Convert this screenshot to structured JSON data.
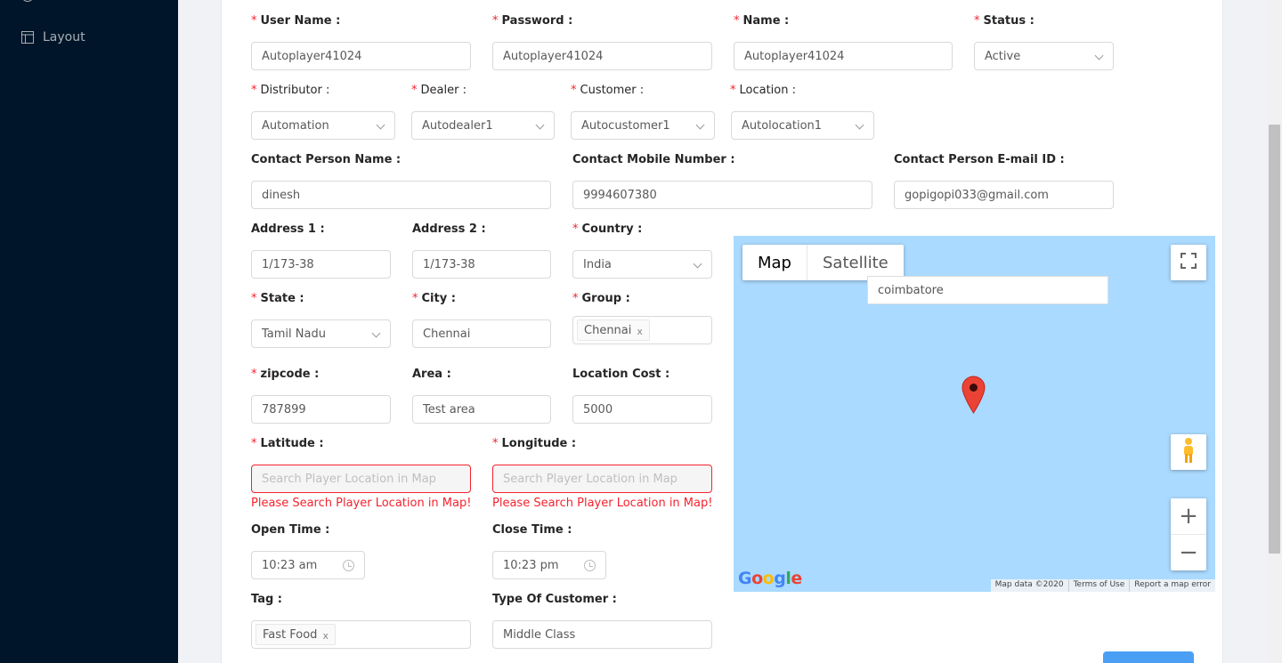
{
  "sidebar": {
    "items": [
      {
        "label": "Layout",
        "icon": "layout-icon"
      }
    ]
  },
  "form": {
    "user_name": {
      "label": "User Name",
      "value": "Autoplayer41024"
    },
    "password": {
      "label": "Password",
      "value": "Autoplayer41024"
    },
    "name": {
      "label": "Name",
      "value": "Autoplayer41024"
    },
    "status": {
      "label": "Status",
      "value": "Active"
    },
    "distributor": {
      "label": "Distributor",
      "value": "Automation"
    },
    "dealer": {
      "label": "Dealer",
      "value": "Autodealer1"
    },
    "customer": {
      "label": "Customer",
      "value": "Autocustomer1"
    },
    "location": {
      "label": "Location",
      "value": "Autolocation1"
    },
    "contact_name": {
      "label": "Contact Person Name",
      "value": "dinesh"
    },
    "contact_mobile": {
      "label": "Contact Mobile Number",
      "value": "9994607380"
    },
    "contact_email": {
      "label": "Contact Person E-mail ID",
      "value": "gopigopi033@gmail.com"
    },
    "address1": {
      "label": "Address 1",
      "value": "1/173-38"
    },
    "address2": {
      "label": "Address 2",
      "value": "1/173-38"
    },
    "country": {
      "label": "Country",
      "value": "India"
    },
    "state": {
      "label": "State",
      "value": "Tamil Nadu"
    },
    "city": {
      "label": "City",
      "value": "Chennai"
    },
    "group": {
      "label": "Group",
      "tag": "Chennai"
    },
    "zipcode": {
      "label": "zipcode",
      "value": "787899"
    },
    "area": {
      "label": "Area",
      "value": "Test area"
    },
    "location_cost": {
      "label": "Location Cost",
      "value": "5000"
    },
    "latitude": {
      "label": "Latitude",
      "placeholder": "Search Player Location in Map",
      "error": "Please Search Player Location in Map!"
    },
    "longitude": {
      "label": "Longitude",
      "placeholder": "Search Player Location in Map",
      "error": "Please Search Player Location in Map!"
    },
    "open_time": {
      "label": "Open Time",
      "value": "10:23 am"
    },
    "close_time": {
      "label": "Close Time",
      "value": "10:23 pm"
    },
    "tag": {
      "label": "Tag",
      "tag": "Fast Food"
    },
    "type_of_customer": {
      "label": "Type Of Customer",
      "value": "Middle Class"
    }
  },
  "map": {
    "type_map": "Map",
    "type_satellite": "Satellite",
    "search_value": "coimbatore",
    "google_logo": "Google",
    "footer": [
      "Map data ©2020",
      "Terms of Use",
      "Report a map error"
    ],
    "zoom_in": "+",
    "zoom_out": "−"
  },
  "colors": {
    "required": "#f5222d",
    "sidebar_bg": "#001529",
    "map_water": "#aadaff",
    "primary": "#4a9ff5"
  }
}
